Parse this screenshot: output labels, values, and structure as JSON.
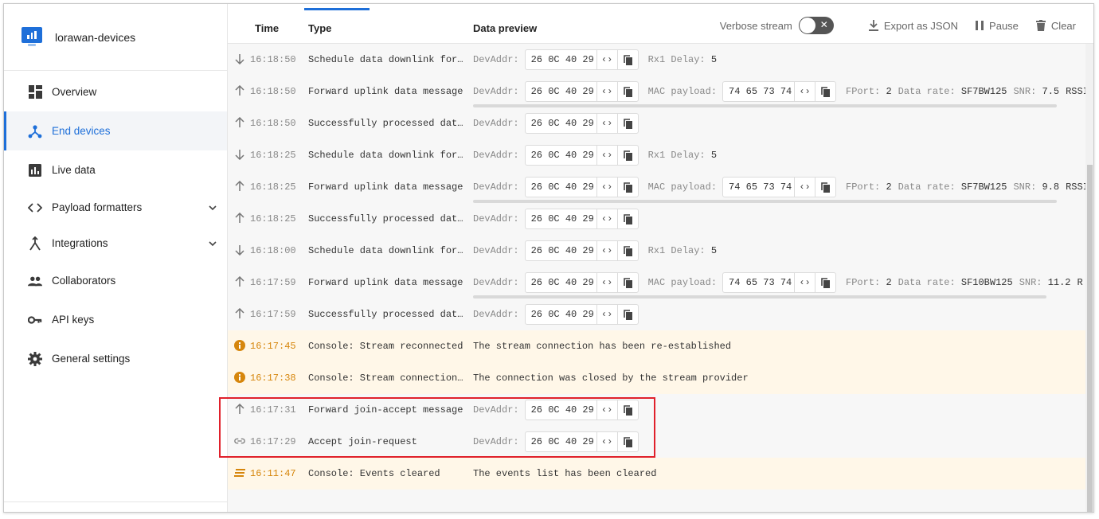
{
  "app": {
    "title": "lorawan-devices"
  },
  "sidebar": {
    "items": [
      {
        "label": "Overview"
      },
      {
        "label": "End devices"
      },
      {
        "label": "Live data"
      },
      {
        "label": "Payload formatters"
      },
      {
        "label": "Integrations"
      },
      {
        "label": "Collaborators"
      },
      {
        "label": "API keys"
      },
      {
        "label": "General settings"
      }
    ]
  },
  "header": {
    "columns": {
      "time": "Time",
      "type": "Type",
      "data": "Data preview"
    },
    "verbose_label": "Verbose stream",
    "export_label": "Export as JSON",
    "pause_label": "Pause",
    "clear_label": "Clear"
  },
  "events": [
    {
      "time": "16:18:50",
      "type": "Schedule data downlink for…",
      "devaddr_label": "DevAddr:",
      "devaddr": "26 0C 40 29",
      "extra": "Rx1 Delay:",
      "extra_value": "5"
    },
    {
      "time": "16:18:50",
      "type": "Forward uplink data message",
      "devaddr_label": "DevAddr:",
      "devaddr": "26 0C 40 29",
      "mac_label": "MAC payload:",
      "mac": "74 65 73 74",
      "fport_label": "FPort:",
      "fport": "2",
      "rate_label": "Data rate:",
      "rate": "SF7BW125",
      "snr_label": "SNR:",
      "snr": "7.5",
      "rssi_label": "RSSI"
    },
    {
      "time": "16:18:50",
      "type": "Successfully processed dat…",
      "devaddr_label": "DevAddr:",
      "devaddr": "26 0C 40 29"
    },
    {
      "time": "16:18:25",
      "type": "Schedule data downlink for…",
      "devaddr_label": "DevAddr:",
      "devaddr": "26 0C 40 29",
      "extra": "Rx1 Delay:",
      "extra_value": "5"
    },
    {
      "time": "16:18:25",
      "type": "Forward uplink data message",
      "devaddr_label": "DevAddr:",
      "devaddr": "26 0C 40 29",
      "mac_label": "MAC payload:",
      "mac": "74 65 73 74",
      "fport_label": "FPort:",
      "fport": "2",
      "rate_label": "Data rate:",
      "rate": "SF7BW125",
      "snr_label": "SNR:",
      "snr": "9.8",
      "rssi_label": "RSSI"
    },
    {
      "time": "16:18:25",
      "type": "Successfully processed dat…",
      "devaddr_label": "DevAddr:",
      "devaddr": "26 0C 40 29"
    },
    {
      "time": "16:18:00",
      "type": "Schedule data downlink for…",
      "devaddr_label": "DevAddr:",
      "devaddr": "26 0C 40 29",
      "extra": "Rx1 Delay:",
      "extra_value": "5"
    },
    {
      "time": "16:17:59",
      "type": "Forward uplink data message",
      "devaddr_label": "DevAddr:",
      "devaddr": "26 0C 40 29",
      "mac_label": "MAC payload:",
      "mac": "74 65 73 74",
      "fport_label": "FPort:",
      "fport": "2",
      "rate_label": "Data rate:",
      "rate": "SF10BW125",
      "snr_label": "SNR:",
      "snr": "11.2",
      "rssi_label": "R"
    },
    {
      "time": "16:17:59",
      "type": "Successfully processed dat…",
      "devaddr_label": "DevAddr:",
      "devaddr": "26 0C 40 29"
    },
    {
      "time": "16:17:45",
      "type": "Console: Stream reconnected",
      "message": "The stream connection has been re-established"
    },
    {
      "time": "16:17:38",
      "type": "Console: Stream connection…",
      "message": "The connection was closed by the stream provider"
    },
    {
      "time": "16:17:31",
      "type": "Forward join-accept message",
      "devaddr_label": "DevAddr:",
      "devaddr": "26 0C 40 29"
    },
    {
      "time": "16:17:29",
      "type": "Accept join-request",
      "devaddr_label": "DevAddr:",
      "devaddr": "26 0C 40 29"
    },
    {
      "time": "16:11:47",
      "type": "Console: Events cleared",
      "message": "The events list has been cleared"
    }
  ],
  "colors": {
    "accent": "#1e6fd9",
    "warning": "#d6860c",
    "highlight": "#e0202b"
  }
}
